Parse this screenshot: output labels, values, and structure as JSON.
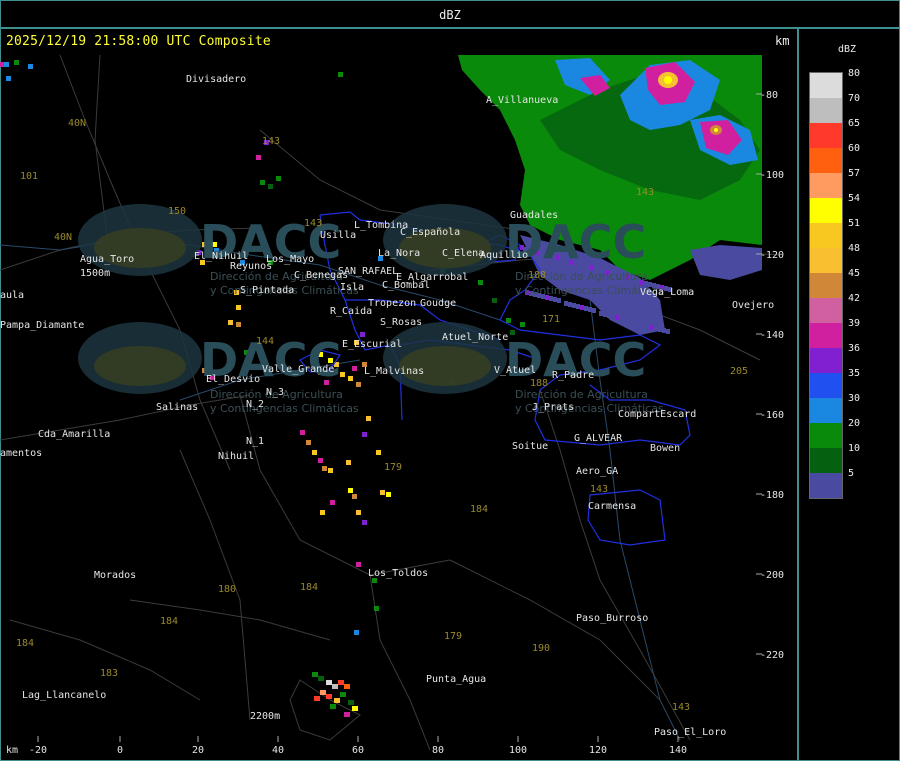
{
  "window": {
    "title": "dBZ"
  },
  "header": {
    "timestamp": "2025/12/19 21:58:00 UTC Composite",
    "units_label": "km"
  },
  "legend": {
    "title": "dBZ",
    "levels": [
      {
        "label": "80",
        "color": "#dcdcdc"
      },
      {
        "label": "70",
        "color": "#bebebe"
      },
      {
        "label": "65",
        "color": "#ff3a2a"
      },
      {
        "label": "60",
        "color": "#ff6010"
      },
      {
        "label": "57",
        "color": "#ff9a60"
      },
      {
        "label": "54",
        "color": "#ffff00"
      },
      {
        "label": "51",
        "color": "#f8c820"
      },
      {
        "label": "48",
        "color": "#f8c030"
      },
      {
        "label": "45",
        "color": "#d08838"
      },
      {
        "label": "42",
        "color": "#d060a0"
      },
      {
        "label": "39",
        "color": "#d020a0"
      },
      {
        "label": "36",
        "color": "#8020d0"
      },
      {
        "label": "35",
        "color": "#2050f0"
      },
      {
        "label": "30",
        "color": "#1a88e0"
      },
      {
        "label": "20",
        "color": "#0a8a0a"
      },
      {
        "label": "10",
        "color": "#056010"
      },
      {
        "label": "5",
        "color": "#4a4aa0"
      }
    ]
  },
  "axes": {
    "x_unit": "km",
    "x_ticks": [
      "-20",
      "0",
      "20",
      "40",
      "60",
      "80",
      "100",
      "120",
      "140"
    ],
    "y_ticks": [
      "-80",
      "-100",
      "-120",
      "-140",
      "-160",
      "-180",
      "-200",
      "-220"
    ]
  },
  "places": [
    "Divisadero",
    "A_Villanueva",
    "Guadales",
    "Usilla",
    "L_Tombina",
    "C_Española",
    "La_Nora",
    "C_Elena",
    "Aquillio",
    "Agua_Toro",
    "Reyunos",
    "El_Nihuil",
    "Los_Mayo",
    "S_Pintada",
    "C_Benegas",
    "SAN_RAFAEL",
    "E_Algarrobal",
    "C_Bombal",
    "Isla",
    "Tropezon",
    "Goudge",
    "R_Caida",
    "S_Rosas",
    "Atuel_Norte",
    "E_Escurial",
    "Valle_Grande",
    "L_Malvinas",
    "V_Atuel",
    "R_Padre",
    "El_Desvio",
    "Salinas",
    "N_3",
    "N_2",
    "N_1",
    "Nihuil",
    "J_Prats",
    "CompartEscard",
    "G_ALVEAR",
    "Soitue",
    "Bowen",
    "Aero_GA",
    "Carmensa",
    "Cda_Amarilla",
    "amentos",
    "aula",
    "Pampa_Diamante",
    "Morados",
    "Los_Toldos",
    "Paso_Burroso",
    "Punta_Agua",
    "Lag_Llancanelo",
    "Paso_El_Loro",
    "Ovejero",
    "Vega_Loma",
    "1500m",
    "2200m"
  ],
  "routes": [
    "40N",
    "40N",
    "101",
    "150",
    "143",
    "143",
    "144",
    "171",
    "143",
    "188",
    "188",
    "179",
    "184",
    "184",
    "180",
    "184",
    "183",
    "184",
    "179",
    "190",
    "143",
    "143",
    "205"
  ],
  "watermark": {
    "brand": "DACC",
    "line1": "Dirección de Agricultura",
    "line2": "y Contingencias Climáticas"
  }
}
